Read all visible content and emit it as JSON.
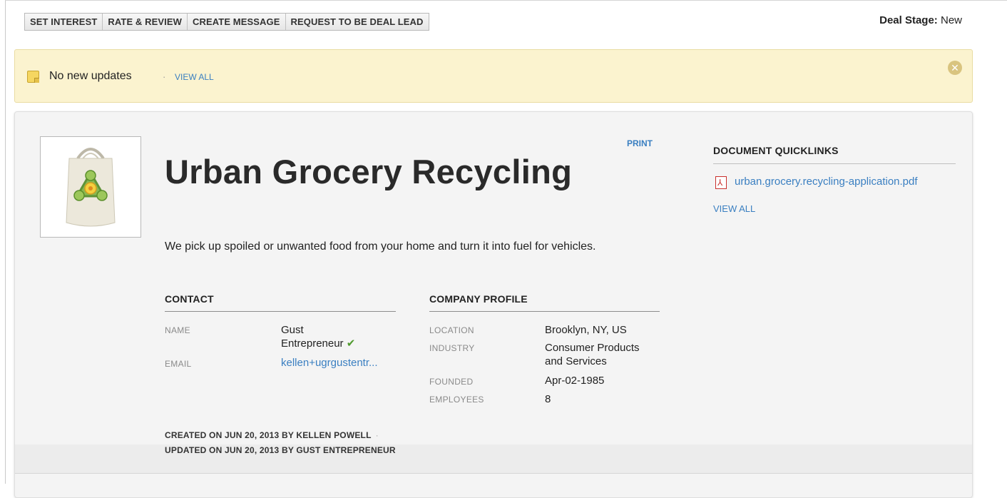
{
  "toolbar": {
    "buttons": [
      "SET INTEREST",
      "RATE & REVIEW",
      "CREATE MESSAGE",
      "REQUEST TO BE DEAL LEAD"
    ],
    "deal_stage_label": "Deal Stage:",
    "deal_stage_value": "New"
  },
  "updates": {
    "text": "No new updates",
    "separator": "·",
    "view_all": "VIEW ALL"
  },
  "company": {
    "name": "Urban Grocery Recycling",
    "print": "PRINT",
    "tagline": "We pick up spoiled or unwanted food from your home and turn it into fuel for vehicles."
  },
  "contact": {
    "title": "CONTACT",
    "name_label": "NAME",
    "name_line1": "Gust",
    "name_line2": "Entrepreneur",
    "email_label": "EMAIL",
    "email_value": "kellen+ugrgustentr..."
  },
  "profile": {
    "title": "COMPANY PROFILE",
    "location_label": "LOCATION",
    "location_value": "Brooklyn, NY, US",
    "industry_label": "INDUSTRY",
    "industry_line1": "Consumer Products",
    "industry_line2": "and Services",
    "founded_label": "FOUNDED",
    "founded_value": "Apr-02-1985",
    "employees_label": "EMPLOYEES",
    "employees_value": "8"
  },
  "meta": {
    "created": "CREATED ON JUN 20, 2013 BY KELLEN POWELL",
    "updated": "UPDATED ON JUN 20, 2013 BY GUST ENTREPRENEUR",
    "separator": "·"
  },
  "quicklinks": {
    "title": "DOCUMENT QUICKLINKS",
    "file": "urban.grocery.recycling-application.pdf",
    "view_all": "VIEW ALL"
  },
  "icons": {
    "note": "note-icon",
    "close": "close-circle-icon",
    "check": "check-icon",
    "pdf": "pdf-icon"
  },
  "colors": {
    "link": "#3a7fc1",
    "notice_bg": "#fbf3cf",
    "card_bg": "#f4f4f4",
    "check": "#4f9a2d",
    "pdf": "#c9302c"
  }
}
